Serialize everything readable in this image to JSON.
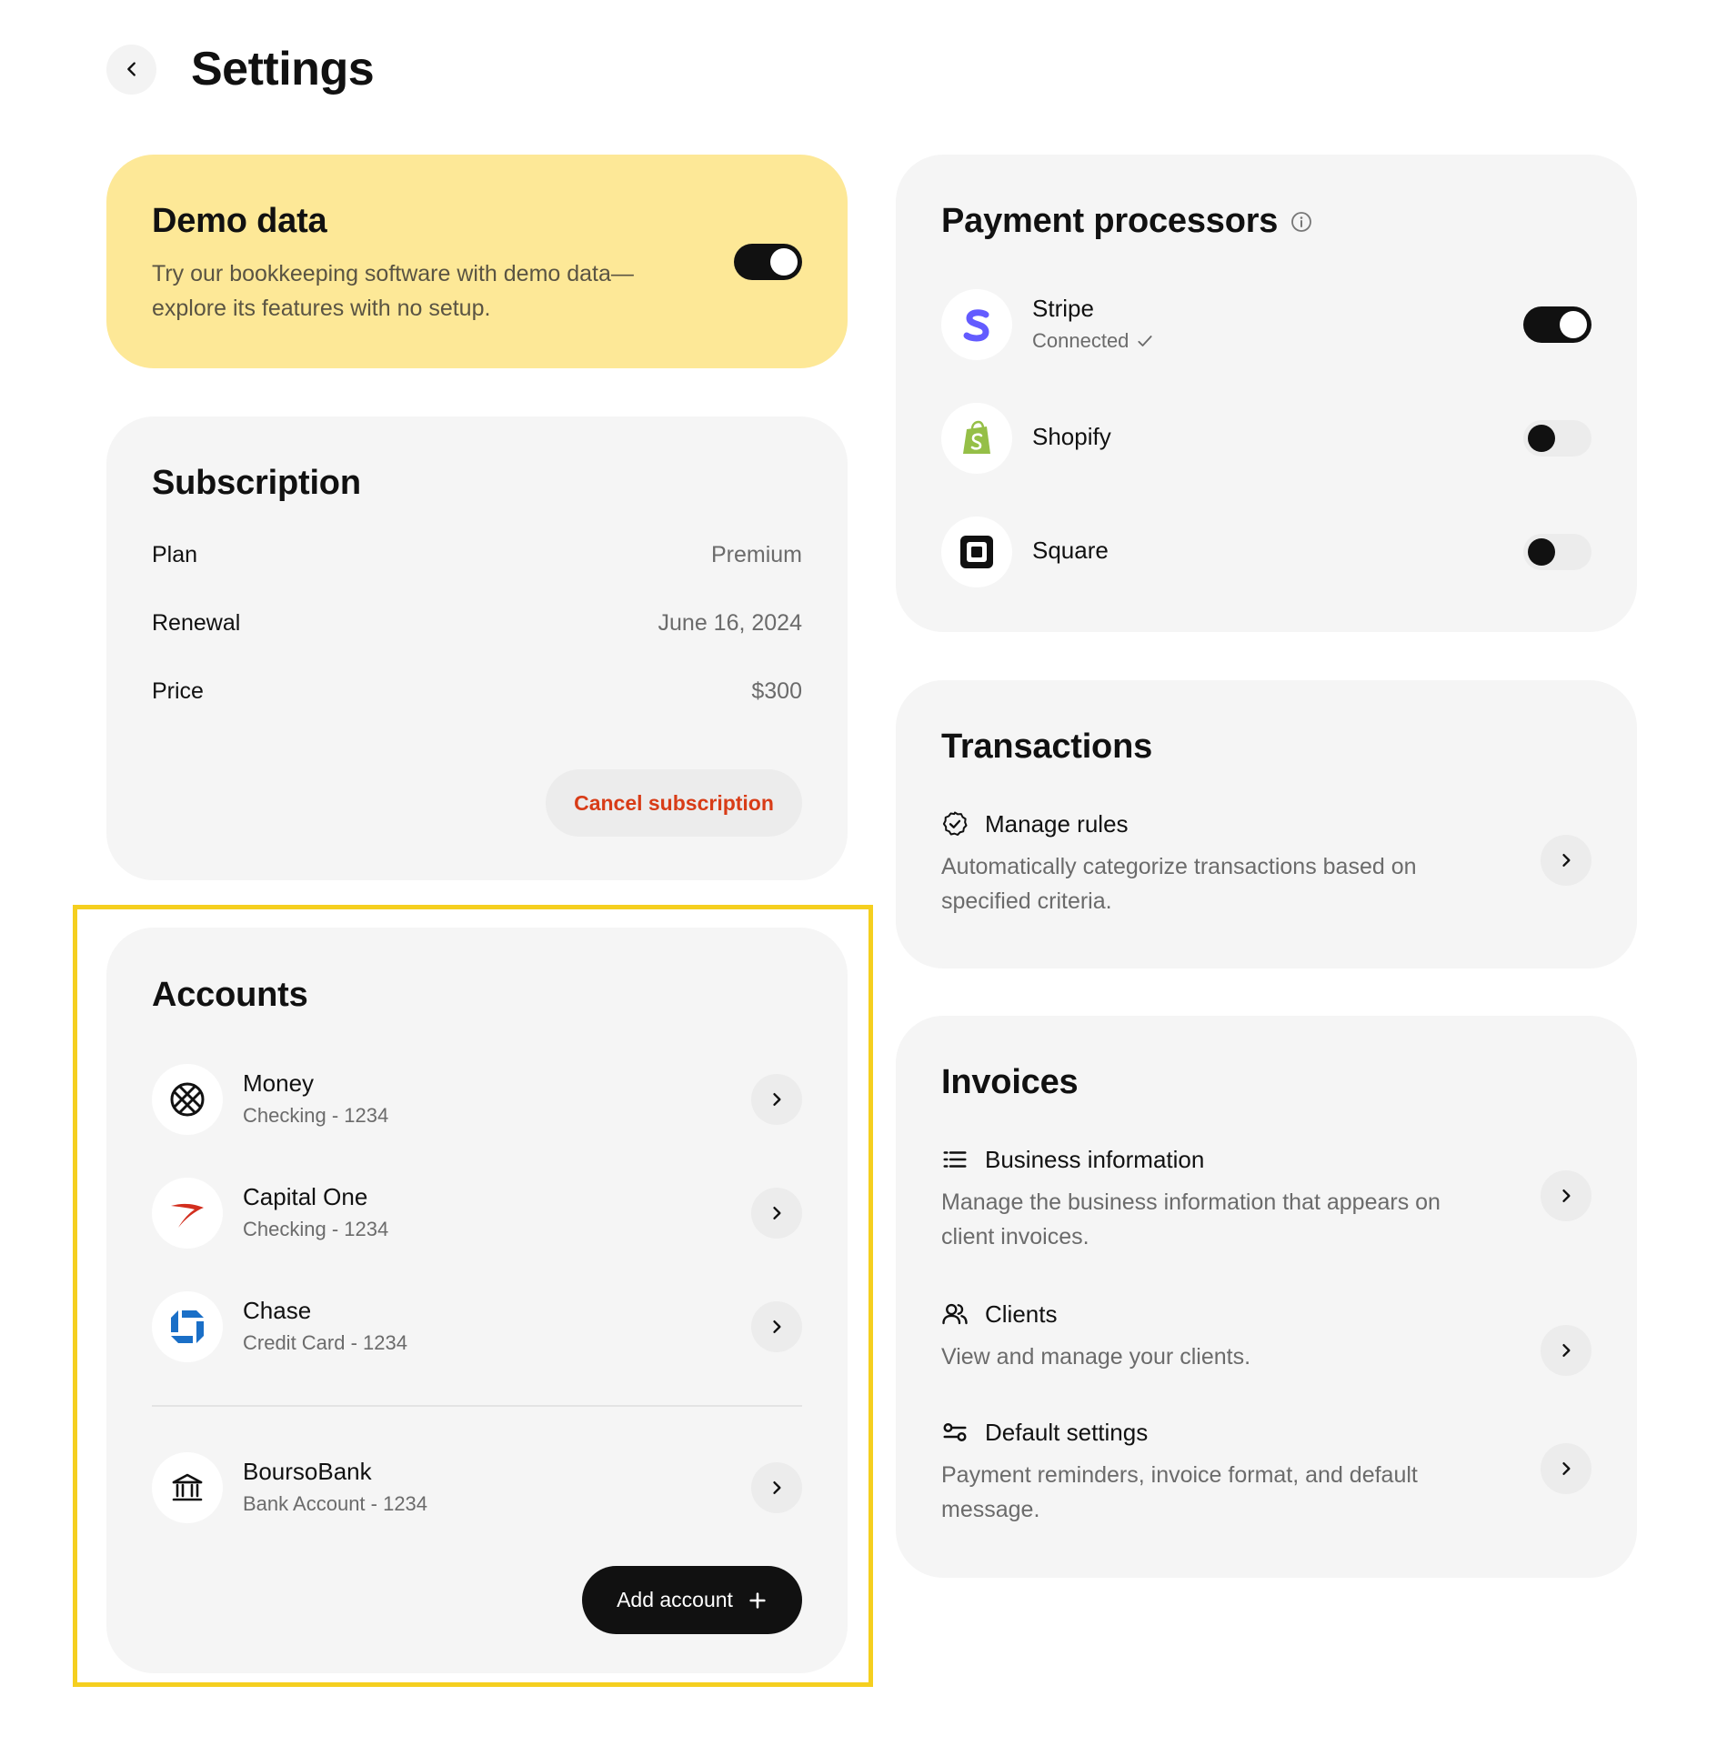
{
  "page": {
    "title": "Settings"
  },
  "demo": {
    "title": "Demo data",
    "description": "Try our bookkeeping software with demo data—explore its features with no setup.",
    "enabled": true
  },
  "subscription": {
    "title": "Subscription",
    "rows": [
      {
        "label": "Plan",
        "value": "Premium"
      },
      {
        "label": "Renewal",
        "value": "June 16, 2024"
      },
      {
        "label": "Price",
        "value": "$300"
      }
    ],
    "cancel_label": "Cancel subscription"
  },
  "accounts": {
    "title": "Accounts",
    "items": [
      {
        "name": "Money",
        "detail": "Checking - 1234",
        "icon": "money-logo-icon"
      },
      {
        "name": "Capital One",
        "detail": "Checking - 1234",
        "icon": "capital-one-logo-icon"
      },
      {
        "name": "Chase",
        "detail": "Credit Card - 1234",
        "icon": "chase-logo-icon"
      },
      {
        "name": "BoursoBank",
        "detail": "Bank Account - 1234",
        "icon": "bank-icon"
      }
    ],
    "add_label": "Add account"
  },
  "processors": {
    "title": "Payment processors",
    "items": [
      {
        "name": "Stripe",
        "status": "Connected",
        "enabled": true,
        "icon": "stripe-logo-icon",
        "color": "#635bff"
      },
      {
        "name": "Shopify",
        "status": "",
        "enabled": false,
        "icon": "shopify-logo-icon",
        "color": "#95bf47"
      },
      {
        "name": "Square",
        "status": "",
        "enabled": false,
        "icon": "square-logo-icon",
        "color": "#000000"
      }
    ]
  },
  "transactions": {
    "title": "Transactions",
    "items": [
      {
        "label": "Manage rules",
        "description": "Automatically categorize transactions based on specified criteria.",
        "icon": "check-circle-icon"
      }
    ]
  },
  "invoices": {
    "title": "Invoices",
    "items": [
      {
        "label": "Business information",
        "description": "Manage the business information that appears on client invoices.",
        "icon": "list-icon"
      },
      {
        "label": "Clients",
        "description": "View and manage your clients.",
        "icon": "users-icon"
      },
      {
        "label": "Default settings",
        "description": "Payment reminders, invoice format, and default message.",
        "icon": "sliders-icon"
      }
    ]
  },
  "colors": {
    "accent_yellow": "#fde897",
    "highlight_yellow": "#f5cf1f",
    "danger": "#d83c17",
    "card_bg": "#f5f5f5"
  }
}
